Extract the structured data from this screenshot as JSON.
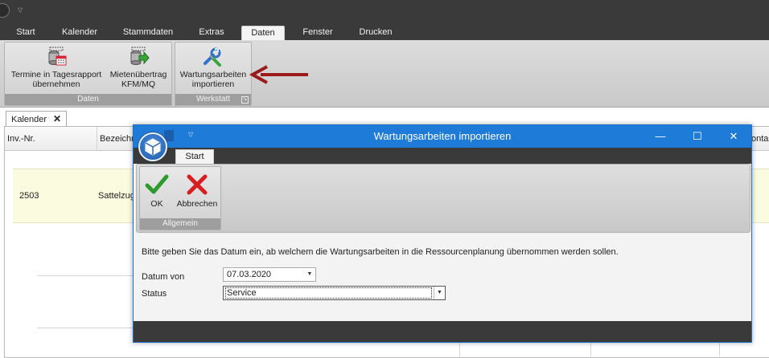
{
  "app": {
    "tabs": [
      {
        "label": "Start"
      },
      {
        "label": "Kalender"
      },
      {
        "label": "Stammdaten"
      },
      {
        "label": "Extras"
      },
      {
        "label": "Daten"
      },
      {
        "label": "Fenster"
      },
      {
        "label": "Drucken"
      }
    ],
    "active_tab": "Daten"
  },
  "ribbon": {
    "groups": [
      {
        "label": "Daten",
        "buttons": [
          {
            "label": "Termine in Tagesrapport\nübernehmen",
            "icon": "calendar-db-icon"
          },
          {
            "label": "Mietenübertrag\nKFM/MQ",
            "icon": "database-transfer-icon"
          }
        ]
      },
      {
        "label": "Werkstatt",
        "buttons": [
          {
            "label": "Wartungsarbeiten\nimportieren",
            "icon": "wrench-screwdriver-icon"
          }
        ]
      }
    ]
  },
  "document": {
    "tab_label": "Kalender",
    "close_glyph": "✕",
    "columns": [
      "Inv.-Nr.",
      "Bezeichn",
      "onta"
    ],
    "row": {
      "inv_nr": "2503",
      "bezeichnung": "Sattelzug"
    }
  },
  "dialog": {
    "title": "Wartungsarbeiten importieren",
    "tab_label": "Start",
    "group_label": "Allgemein",
    "ok_label": "OK",
    "cancel_label": "Abbrechen",
    "instruction": "Bitte geben Sie das Datum ein, ab welchem die Wartungsarbeiten in die Ressourcenplanung übernommen werden sollen.",
    "date_label": "Datum von",
    "date_value": "07.03.2020",
    "status_label": "Status",
    "status_value": "Service",
    "ctrl_minimize": "—",
    "ctrl_maximize": "☐",
    "ctrl_close": "✕"
  },
  "colors": {
    "dialog_title": "#1f7bd8",
    "annotation_arrow": "#9b1b1b",
    "highlight_row": "#fbfbe0"
  }
}
